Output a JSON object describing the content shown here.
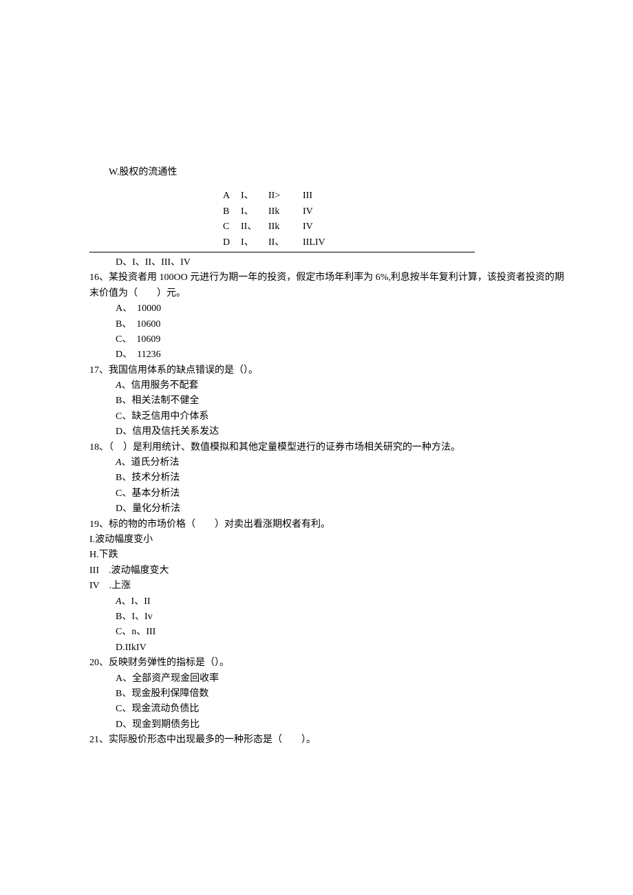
{
  "top_line": "W.股权的流通性",
  "box": {
    "rA": {
      "l": "A",
      "c1": "I、",
      "c2": "II>",
      "c3": "III"
    },
    "rB": {
      "l": "B",
      "c1": "I、",
      "c2": "IIk",
      "c3": "IV"
    },
    "rC": {
      "l": "C",
      "c1": "II、",
      "c2": "IIk",
      "c3": "IV"
    },
    "rD": {
      "l": "D",
      "c1": "I、",
      "c2": "II、",
      "c3": "IILIV"
    }
  },
  "opt_d": "D、I、II、III、IV",
  "q16": {
    "text": "16、某投资者用 100OO 元进行为期一年的投资，假定市场年利率为 6%,利息按半年复利计算，该投资者投资的期末价值为（　　）元。",
    "a": "A、　10000",
    "b": "B、　10600",
    "c": "C、　10609",
    "d": "D、　11236"
  },
  "q17": {
    "text": "17、我国信用体系的缺点错误的是（）。",
    "a_label": "A",
    "a_text": "、信用服务不配套",
    "b": "B、相关法制不健全",
    "c": "C、缺乏信用中介体系",
    "d": "D、信用及信托关系发达"
  },
  "q18": {
    "text": "18、（　）是利用统计、数值模拟和其他定量模型进行的证券市场相关研究的一种方法。",
    "a_label": "A",
    "a_text": "、道氏分析法",
    "b": "B、技术分析法",
    "c": "C、基本分析法",
    "d": "D、量化分析法"
  },
  "q19": {
    "text": "19、标的物的市场价格（　　）对卖出看涨期权者有利。",
    "s1": "I.波动幅度变小",
    "s2": "H.下跌",
    "s3": "III　.波动幅度变大",
    "s4": "IV　.上涨",
    "a_label": "A",
    "a_text": "、I、II",
    "b": "B、I、Iv",
    "c": "C、n、III",
    "d": "D.IIkIV"
  },
  "q20": {
    "text": "20、反映财务弹性的指标是（）。",
    "a": "A、全部资产现金回收率",
    "b": "B、现金股利保障倍数",
    "c": "C、现金流动负债比",
    "d": "D、现金到期债务比"
  },
  "q21": {
    "text": "21、实际股价形态中出现最多的一种形态是（　　）。"
  }
}
